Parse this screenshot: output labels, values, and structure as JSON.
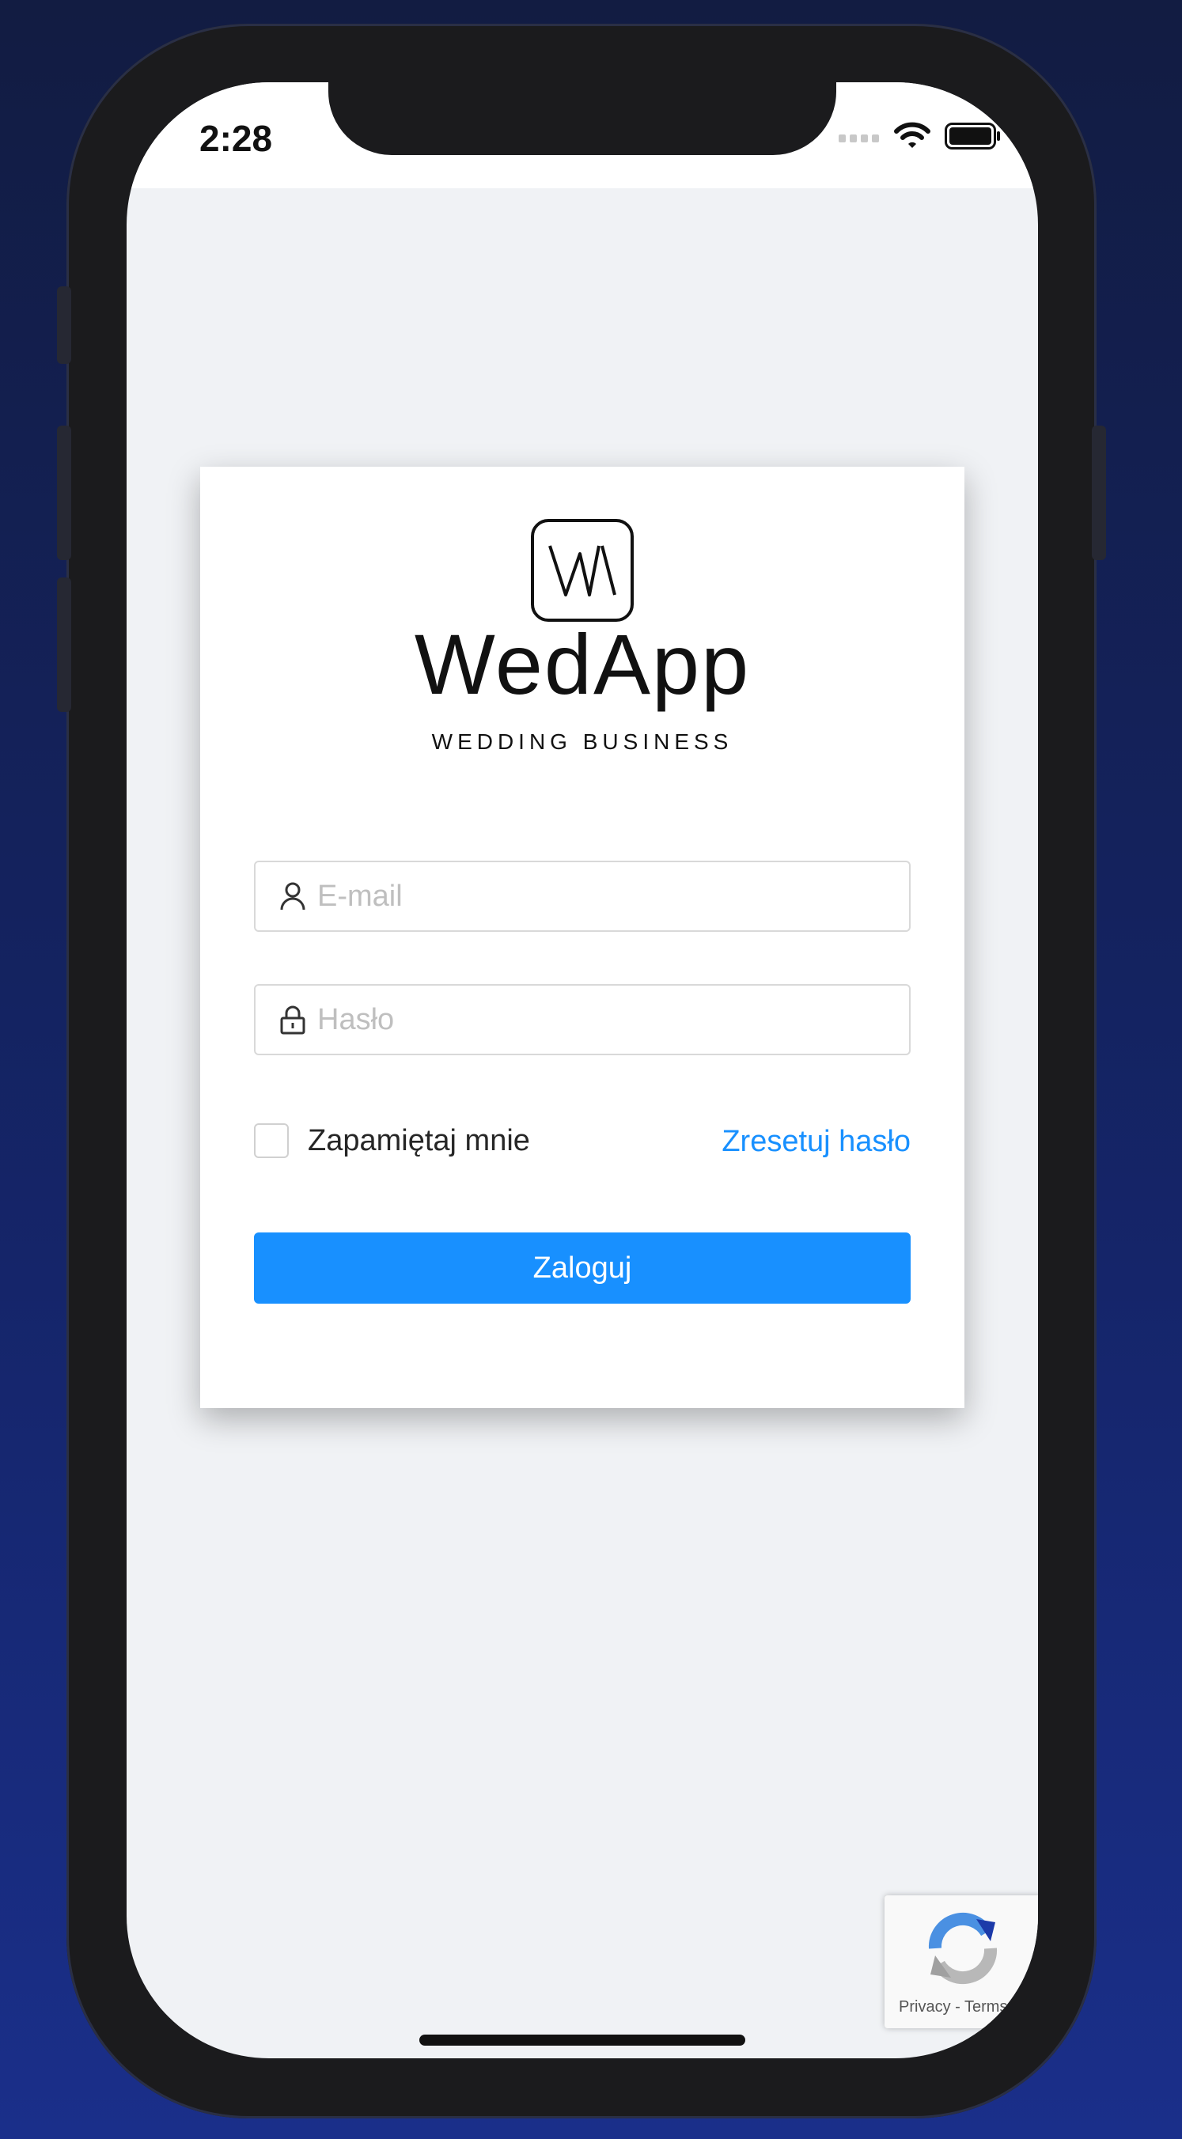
{
  "status_bar": {
    "time": "2:28"
  },
  "brand": {
    "name": "WedApp",
    "tagline": "WEDDING BUSINESS"
  },
  "login_form": {
    "email_placeholder": "E-mail",
    "password_placeholder": "Hasło",
    "remember_label": "Zapamiętaj mnie",
    "reset_link": "Zresetuj hasło",
    "submit_label": "Zaloguj"
  },
  "recaptcha": {
    "privacy": "Privacy",
    "separator": "-",
    "terms": "Terms"
  },
  "colors": {
    "primary": "#1890ff",
    "background": "#f0f2f5",
    "card": "#ffffff"
  }
}
